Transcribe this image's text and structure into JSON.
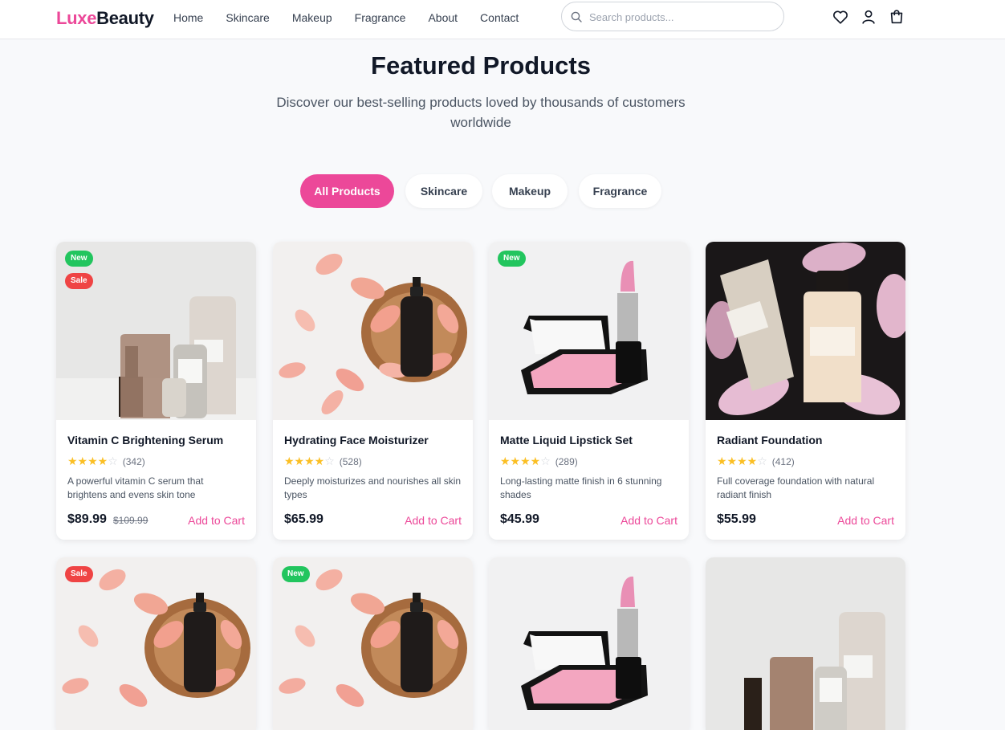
{
  "brand": {
    "part1": "Luxe",
    "part2": "Beauty"
  },
  "nav": [
    "Home",
    "Skincare",
    "Makeup",
    "Fragrance",
    "About",
    "Contact"
  ],
  "search": {
    "placeholder": "Search products..."
  },
  "header_icons": [
    "heart-icon",
    "user-icon",
    "shopping-bag-icon"
  ],
  "hero": {
    "title": "Featured Products",
    "subtitle": "Discover our best-selling products loved by thousands of customers worldwide"
  },
  "filters": [
    {
      "label": "All Products",
      "active": true
    },
    {
      "label": "Skincare",
      "active": false
    },
    {
      "label": "Makeup",
      "active": false
    },
    {
      "label": "Fragrance",
      "active": false
    }
  ],
  "products": [
    {
      "name": "Vitamin C Brightening Serum",
      "rating": 4,
      "reviews": "(342)",
      "description": "A powerful vitamin C serum that brightens and evens skin tone",
      "price": "$89.99",
      "old_price": "$109.99",
      "badges": [
        "New",
        "Sale"
      ],
      "add_label": "Add to Cart"
    },
    {
      "name": "Hydrating Face Moisturizer",
      "rating": 4,
      "reviews": "(528)",
      "description": "Deeply moisturizes and nourishes all skin types",
      "price": "$65.99",
      "old_price": "",
      "badges": [],
      "add_label": "Add to Cart"
    },
    {
      "name": "Matte Liquid Lipstick Set",
      "rating": 4,
      "reviews": "(289)",
      "description": "Long-lasting matte finish in 6 stunning shades",
      "price": "$45.99",
      "old_price": "",
      "badges": [
        "New"
      ],
      "add_label": "Add to Cart"
    },
    {
      "name": "Radiant Foundation",
      "rating": 4,
      "reviews": "(412)",
      "description": "Full coverage foundation with natural radiant finish",
      "price": "$55.99",
      "old_price": "",
      "badges": [],
      "add_label": "Add to Cart"
    }
  ],
  "second_row_badges": [
    [
      "Sale"
    ],
    [
      "New"
    ],
    [],
    []
  ]
}
